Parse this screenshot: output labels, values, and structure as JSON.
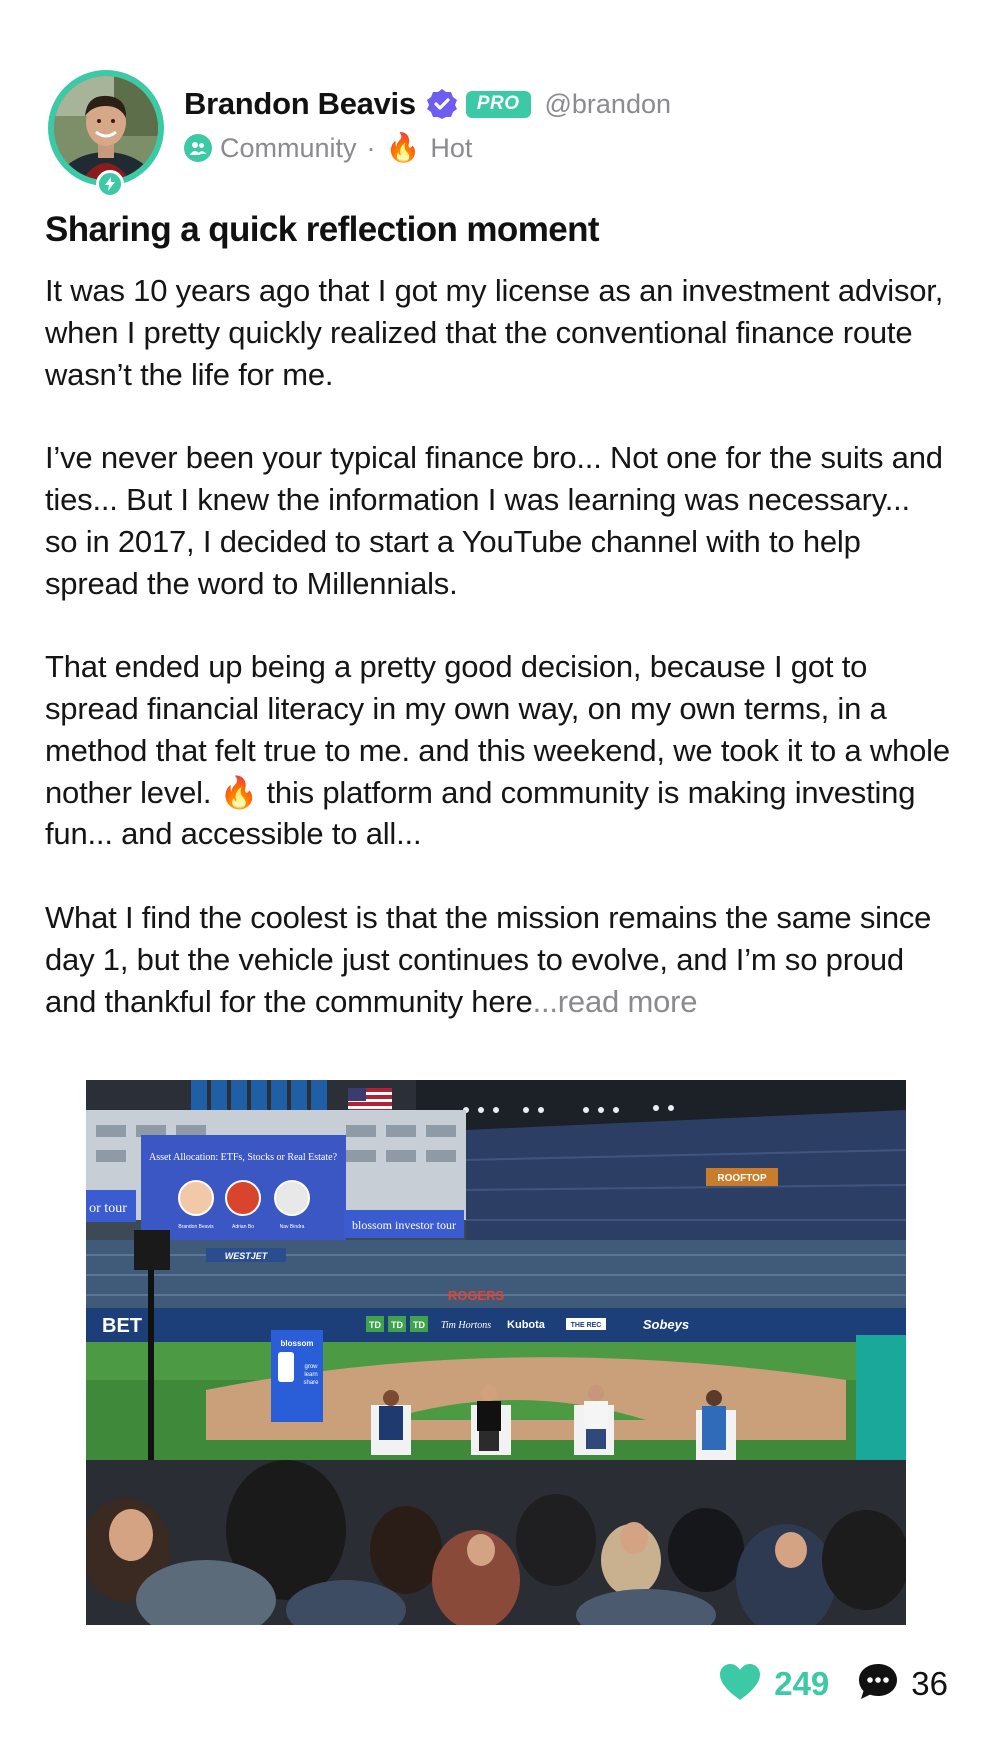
{
  "author": {
    "name": "Brandon Beavis",
    "badge": "PRO",
    "handle": "@brandon",
    "community": "Community",
    "separator": "·",
    "tag": "Hot",
    "verified_icon": "verified-check-icon",
    "accent_color": "#3cc9a6"
  },
  "post": {
    "title": "Sharing a quick reflection moment",
    "paragraphs": [
      "It was 10 years ago that I got my license as an investment advisor, when I pretty quickly realized that the conventional finance route wasn’t the life for me.",
      "I’ve never been your typical finance bro... Not one for the suits and ties... But I knew the information I was learning was necessary... so in 2017, I decided to start a YouTube channel with to help spread the word to Millennials.",
      "That ended up being a pretty good decision, because I got to spread financial literacy in my own way, on my own terms, in a method that felt true to me. and this weekend, we took it to a whole nother level. 🔥 this platform and community is making investing fun... and accessible to all...",
      "What I find the coolest is that the mission remains the same since day 1, but the vehicle just continues to evolve, and I’m so proud and thankful for the community here"
    ],
    "read_more": "...read more"
  },
  "photo": {
    "screen_title": "Asset Allocation: ETFs, Stocks or Real Estate?",
    "screen_footer": "blossom investor tour",
    "tour_text": "or tour",
    "bet_sign": "BET",
    "westjet": "WESTJET",
    "rogers": "ROGERS",
    "banner": "blossom",
    "banner_lines": [
      "grow",
      "learn",
      "share"
    ],
    "ads": [
      "TD",
      "TD",
      "TD",
      "Tim Hortons",
      "Kubota",
      "THE REC",
      "Sobeys"
    ],
    "rooftop": "ROOFTOP",
    "panelists": [
      "Brandon Beavis",
      "Adrian Bo",
      "Nav Bindra"
    ]
  },
  "stats": {
    "likes": "249",
    "comments": "36",
    "like_color": "#3cc9a6"
  }
}
